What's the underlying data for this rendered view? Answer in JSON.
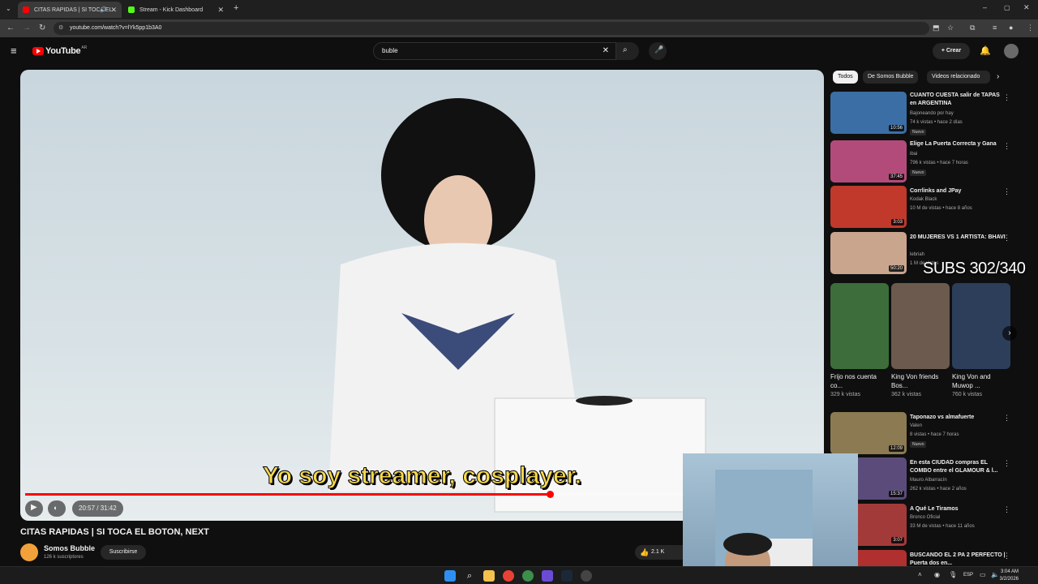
{
  "browser": {
    "tabs": [
      {
        "title": "CITAS RAPIDAS | SI TOCA EL",
        "active": true,
        "favicon_color": "#ff0000"
      },
      {
        "title": "Stream - Kick Dashboard",
        "active": false,
        "favicon_color": "#53fc18"
      }
    ],
    "url": "youtube.com/watch?v=lYk5pp1b3A0"
  },
  "youtube": {
    "logo": "YouTube",
    "region": "AR",
    "search_value": "buble",
    "create_label": "Crear",
    "video": {
      "subtitle": "Yo soy streamer, cosplayer.",
      "time": "20:57 / 31:42",
      "progress": 0.66,
      "title": "CITAS RAPIDAS | SI TOCA EL BOTON, NEXT",
      "channel": "Somos Bubble",
      "subscribers": "126 k suscriptores",
      "subscribe_label": "Suscribirse",
      "likes": "2.1 K"
    },
    "chips": [
      "Todos",
      "De Somos Bubble",
      "Videos relacionado"
    ],
    "recommendations_top": [
      {
        "title": "CUANTO CUESTA salir de TAPAS en ARGENTINA",
        "channel": "Bajoneando por hay",
        "meta": "74 k vistas • hace 2 días",
        "duration": "10:56",
        "badge": "Nuevo",
        "thumb": "#3b6ea5"
      },
      {
        "title": "Elige La Puerta Correcta y Gana",
        "channel": "ibai",
        "meta": "796 k vistas • hace 7 horas",
        "duration": "37:45",
        "badge": "Nuevo",
        "thumb": "#b34b7a"
      },
      {
        "title": "Corrlinks and JPay",
        "channel": "Kodak Black",
        "meta": "10 M de vistas • hace 8 años",
        "duration": "3:03",
        "badge": "",
        "thumb": "#c0392b"
      },
      {
        "title": "20 MUJERES VS 1 ARTISTA: BHAVI",
        "channel": "lebriah",
        "meta": "1 M de vistas",
        "duration": "50:20",
        "badge": "",
        "thumb": "#c9a58e"
      }
    ],
    "shorts": [
      {
        "title": "Frijo nos cuenta co...",
        "views": "329 k vistas",
        "thumb": "#3c6d3a"
      },
      {
        "title": "King Von friends Bos...",
        "views": "362 k vistas",
        "thumb": "#6b5a4d"
      },
      {
        "title": "King Von and Muwop ...",
        "views": "760 k vistas",
        "thumb": "#2c3e5a"
      }
    ],
    "recommendations_bottom": [
      {
        "title": "Taponazo vs almafuerte",
        "channel": "Valen",
        "meta": "8 vistas • hace 7 horas",
        "duration": "12:09",
        "badge": "Nuevo",
        "thumb": "#8b7a52"
      },
      {
        "title": "En esta CIUDAD compras EL COMBO entre el GLAMOUR & l...",
        "channel": "Mauro Albarracín",
        "meta": "262 k vistas • hace 2 años",
        "duration": "15:37",
        "badge": "",
        "thumb": "#5b4b7a"
      },
      {
        "title": "A Qué Le Tiramos",
        "channel": "Bronco Oficial",
        "meta": "33 M de vistas • hace 11 años",
        "duration": "3:07",
        "badge": "",
        "thumb": "#a33a3a"
      },
      {
        "title": "BUSCANDO EL 2 PA 2 PERFECTO | Puerta dos en...",
        "channel": "",
        "meta": "",
        "duration": "",
        "badge": "",
        "thumb": "#b03030"
      }
    ]
  },
  "overlay": {
    "subs_counter": "SUBS 302/340"
  },
  "taskbar": {
    "language": "ESP",
    "time": "3:04 AM",
    "date": "3/2/2026"
  }
}
